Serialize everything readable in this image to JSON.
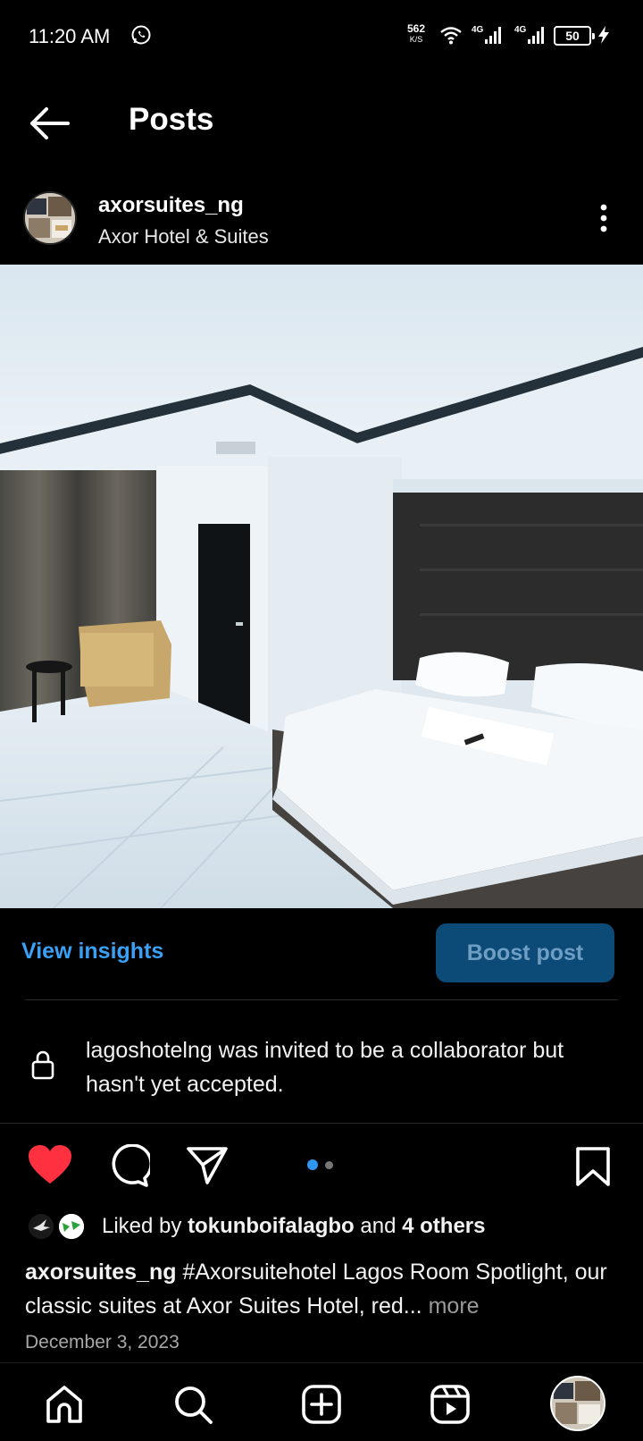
{
  "status_bar": {
    "time": "11:20 AM",
    "speed_value": "562",
    "speed_unit": "K/S",
    "network1": "4G",
    "network2": "4G",
    "battery": "50"
  },
  "header": {
    "title": "Posts",
    "back_icon": "arrow-left-icon"
  },
  "post": {
    "username": "axorsuites_ng",
    "location": "Axor Hotel & Suites",
    "image_alt": "hotel room with bed",
    "insights_label": "View insights",
    "boost_label": "Boost post",
    "collab_notice": "lagoshotelng was invited to be a collaborator but hasn't yet accepted.",
    "liked_prefix": "Liked by ",
    "liked_user": "tokunboifalagbo",
    "liked_middle": " and ",
    "liked_others": "4 others",
    "caption_user": "axorsuites_ng",
    "caption_text": " #Axorsuitehotel Lagos Room Spotlight, our classic suites at Axor Suites Hotel, red...",
    "caption_more": " more",
    "date": "December 3, 2023",
    "liked": true,
    "carousel_index": 1,
    "carousel_count": 2
  },
  "colors": {
    "accent_blue": "#3aa0f5",
    "like_red": "#ff3040",
    "boost_bg": "#0c4b78"
  },
  "nav": [
    "home-icon",
    "search-icon",
    "create-icon",
    "reels-icon",
    "profile-avatar"
  ]
}
